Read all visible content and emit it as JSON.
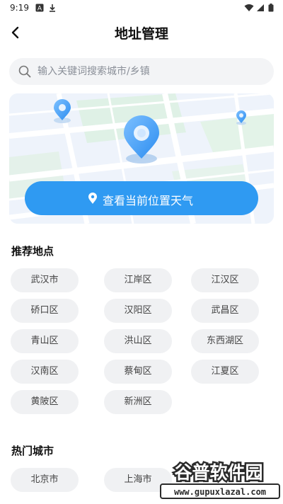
{
  "status_bar": {
    "time": "9:19",
    "left_icons": [
      "a-badge-icon",
      "download-icon"
    ],
    "right_icons": [
      "wifi-icon",
      "signal-icon",
      "battery-icon"
    ]
  },
  "header": {
    "title": "地址管理",
    "back_icon": "chevron-left-icon"
  },
  "search": {
    "placeholder": "输入关键词搜索城市/乡镇",
    "icon": "search-icon"
  },
  "map": {
    "button_label": "查看当前位置天气",
    "button_icon": "location-pin-icon",
    "accent_color": "#2f9af2"
  },
  "recommended": {
    "title": "推荐地点",
    "places": [
      "武汉市",
      "江岸区",
      "江汉区",
      "硚口区",
      "汉阳区",
      "武昌区",
      "青山区",
      "洪山区",
      "东西湖区",
      "汉南区",
      "蔡甸区",
      "江夏区",
      "黄陂区",
      "新洲区"
    ]
  },
  "hot_cities": {
    "title": "热门城市",
    "cities": [
      "北京市",
      "上海市"
    ]
  },
  "watermark": {
    "brand": "谷普软件园",
    "url": "www.gupuxlazal.com"
  }
}
